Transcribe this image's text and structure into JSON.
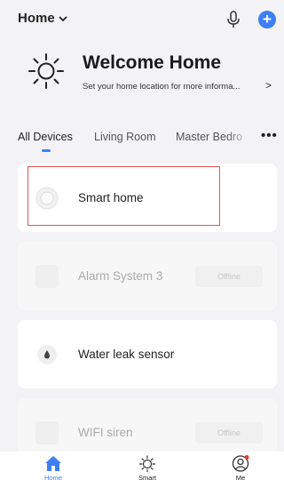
{
  "header": {
    "home_label": "Home",
    "dropdown_icon": "chevron-down-icon",
    "mic_icon": "microphone-icon",
    "add_icon": "plus-circle-icon",
    "add_symbol": "+"
  },
  "welcome": {
    "title": "Welcome Home",
    "subtitle": "Set your home location for more informa...",
    "arrow": ">",
    "icon": "sun-icon"
  },
  "tabs": [
    {
      "label": "All Devices",
      "active": true
    },
    {
      "label": "Living Room",
      "active": false
    },
    {
      "label": "Master Bedro",
      "active": false
    }
  ],
  "more_label": "•••",
  "devices": [
    {
      "name": "Smart home",
      "status": "online",
      "icon": "round-device-icon",
      "highlighted": true
    },
    {
      "name": "Alarm System 3",
      "status": "offline",
      "badge": "Offline",
      "icon": "square-device-icon"
    },
    {
      "name": "Water leak sensor",
      "status": "online",
      "icon": "water-drop-icon"
    },
    {
      "name": "WIFI siren",
      "status": "offline",
      "badge": "Offline",
      "icon": "square-device-icon"
    }
  ],
  "bottom_nav": [
    {
      "label": "Home",
      "icon": "home-icon",
      "active": true
    },
    {
      "label": "Smart",
      "icon": "sun-outline-icon",
      "active": false
    },
    {
      "label": "Me",
      "icon": "user-icon",
      "active": false
    }
  ],
  "colors": {
    "accent": "#3f7ff5",
    "highlight_border": "#e25555",
    "background": "#f3f3f5"
  }
}
